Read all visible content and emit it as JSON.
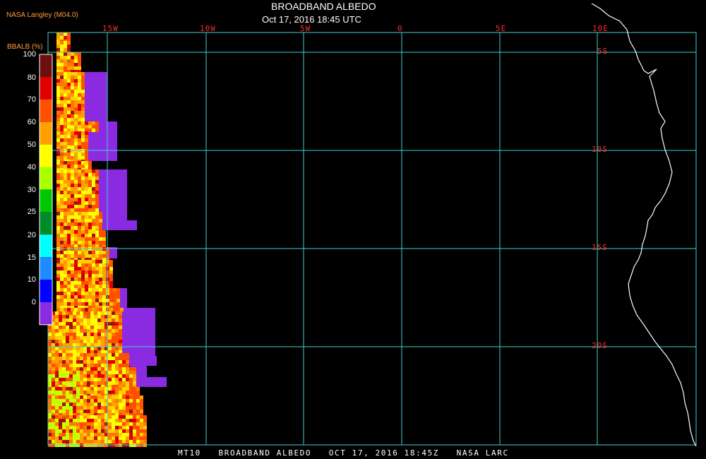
{
  "header": {
    "producer": "NASA Langley (M04.0)",
    "title": "BROADBAND ALBEDO",
    "subtitle": "Oct 17, 2016 18:45 UTC"
  },
  "footer": {
    "text": "MT10   BROADBAND ALBEDO   OCT 17, 2016 18:45Z   NASA LARC"
  },
  "map": {
    "lon_labels": [
      "15W",
      "10W",
      "5W",
      "0",
      "5E",
      "10E"
    ],
    "lat_labels": [
      "5S",
      "10S",
      "15S",
      "20S"
    ],
    "grid_color": "#3fd0d0",
    "coast_color": "#ffffff",
    "label_color": "#ff2a2a"
  },
  "colorbar": {
    "title": "BBALB (%)",
    "ticks": [
      "100",
      "80",
      "70",
      "60",
      "50",
      "40",
      "30",
      "25",
      "20",
      "15",
      "10",
      "0"
    ],
    "colors": [
      "#6e0f0f",
      "#e00000",
      "#ff5000",
      "#ffa000",
      "#ffff00",
      "#a8ff00",
      "#00c800",
      "#008c28",
      "#00ffff",
      "#1e8cff",
      "#0000ff",
      "#8a2be2"
    ]
  },
  "palette": {
    "no_data": "#8a2be2",
    "cloud": [
      "#ffff00",
      "#ffd200",
      "#ffa000",
      "#ff7800",
      "#ff5000",
      "#e00000",
      "#a01010",
      "#c8ff00"
    ]
  }
}
